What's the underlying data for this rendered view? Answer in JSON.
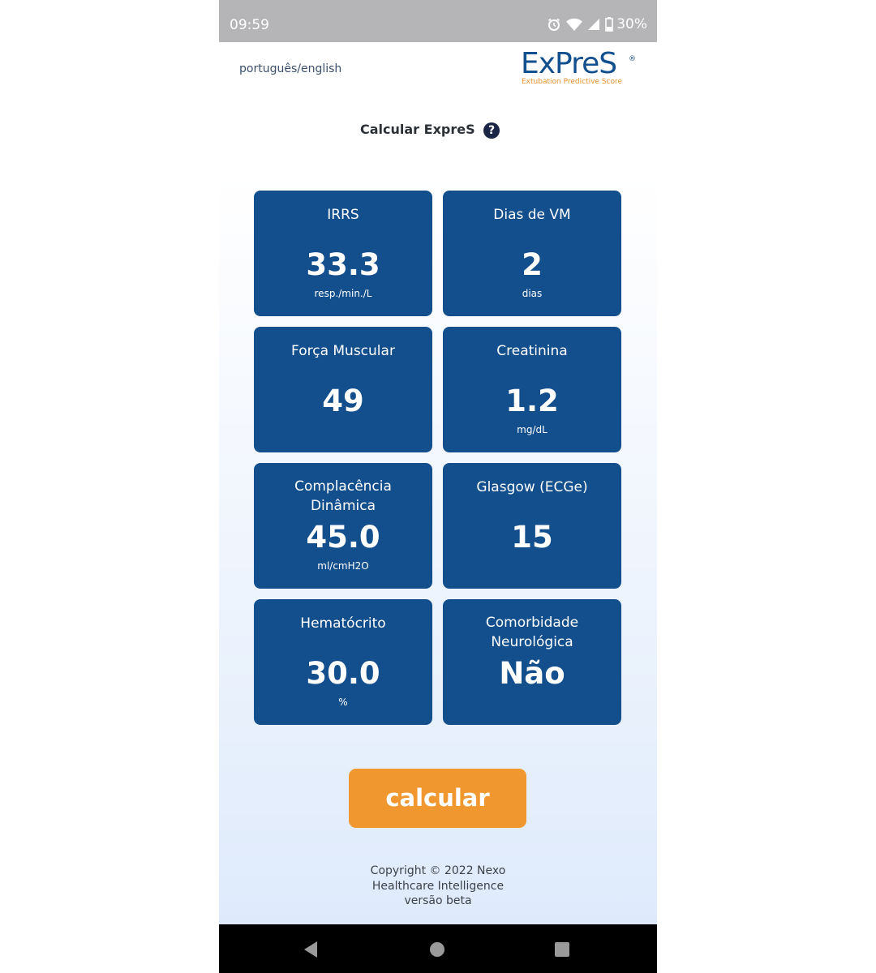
{
  "status_bar": {
    "time": "09:59",
    "battery_percent": "30%",
    "icons": [
      "alarm-icon",
      "wifi-icon",
      "signal-icon",
      "battery-icon"
    ]
  },
  "header": {
    "language_link": "português/english",
    "logo": {
      "name": "ExPreS",
      "registered_mark": "®",
      "tagline": "Extubation Predictive Score"
    }
  },
  "page": {
    "title": "Calcular ExpreS",
    "help_icon_label": "?"
  },
  "cards": [
    {
      "label": "IRRS",
      "value": "33.3",
      "unit": "resp./min./L"
    },
    {
      "label": "Dias de VM",
      "value": "2",
      "unit": "dias"
    },
    {
      "label": "Força Muscular",
      "value": "49",
      "unit": ""
    },
    {
      "label": "Creatinina",
      "value": "1.2",
      "unit": "mg/dL"
    },
    {
      "label": "Complacência Dinâmica",
      "value": "45.0",
      "unit": "ml/cmH2O"
    },
    {
      "label": "Glasgow (ECGe)",
      "value": "15",
      "unit": ""
    },
    {
      "label": "Hematócrito",
      "value": "30.0",
      "unit": "%"
    },
    {
      "label": "Comorbidade Neurológica",
      "value": "Não",
      "unit": ""
    }
  ],
  "actions": {
    "calculate_label": "calcular"
  },
  "footer": {
    "copyright_line1": "Copyright © 2022 Nexo",
    "copyright_line2": "Healthcare Intelligence",
    "version": "versão beta"
  },
  "navigation": {
    "icons": [
      "back-icon",
      "home-icon",
      "recents-icon"
    ]
  },
  "colors": {
    "card_background": "#134f8d",
    "accent_orange": "#f0982f",
    "logo_blue": "#13508f",
    "status_bar": "#b5b4b7",
    "nav_bar": "#000000"
  }
}
